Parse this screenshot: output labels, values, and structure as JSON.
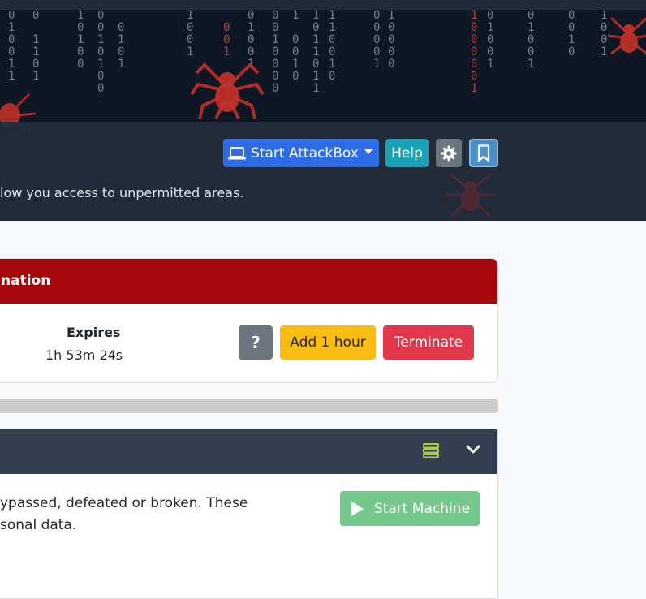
{
  "header": {
    "attackbox_label": "Start AttackBox",
    "help_label": "Help",
    "description": "low you access to unpermitted areas."
  },
  "info_panel": {
    "title": "nation",
    "expires_label": "Expires",
    "expires_value": "1h 53m 24s",
    "question_label": "?",
    "add_hour_label": "Add 1 hour",
    "terminate_label": "Terminate",
    "progress": 0
  },
  "task": {
    "text_line1": "ypassed, defeated or broken. These",
    "text_line2": "sonal data.",
    "start_machine_label": "Start Machine"
  },
  "colors": {
    "panel_header": "#a30709",
    "attackbox": "#2e6ce6",
    "help": "#17a2b8",
    "add_hour": "#fcbc13",
    "terminate": "#e0374a",
    "start_machine": "#75c88b",
    "task_header": "#323d50"
  },
  "icons": [
    "laptop-icon",
    "gear-icon",
    "bookmark-icon",
    "server-icon",
    "chevron-down-icon",
    "play-icon",
    "spider-icon"
  ]
}
